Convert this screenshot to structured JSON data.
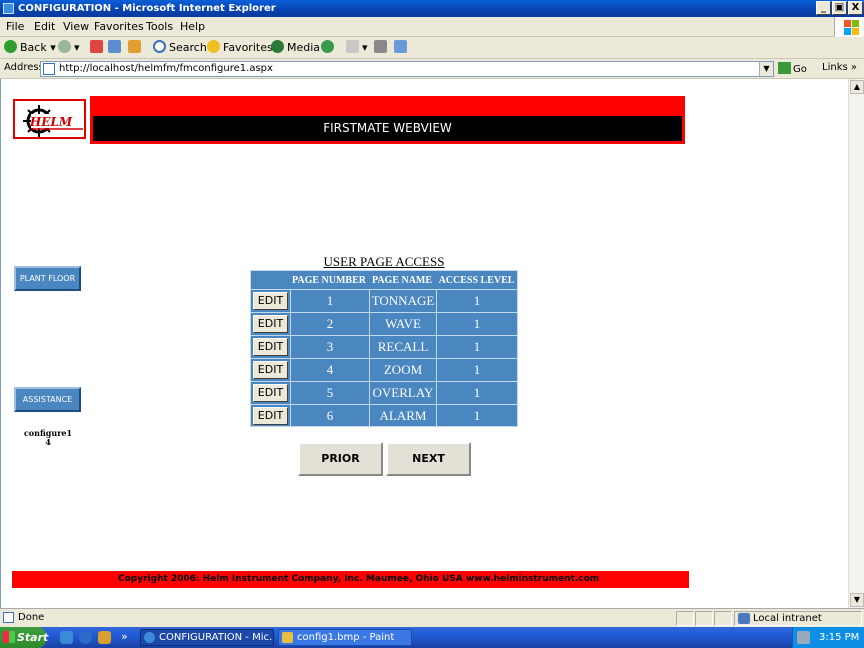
{
  "window": {
    "title": "CONFIGURATION - Microsoft Internet Explorer",
    "min_label": "_",
    "max_label": "▣",
    "close_label": "X"
  },
  "menu": [
    "File",
    "Edit",
    "View",
    "Favorites",
    "Tools",
    "Help"
  ],
  "toolbar": {
    "back": "Back",
    "search": "Search",
    "favorites": "Favorites",
    "media": "Media"
  },
  "address": {
    "label": "Address",
    "url": "http://localhost/helmfm/fmconfigure1.aspx",
    "go": "Go",
    "links": "Links",
    "links_arrow": "»"
  },
  "page": {
    "logo_text": "HELM",
    "header_title": "FIRSTMATE WEBVIEW",
    "side_buttons": {
      "plant_floor": "PLANT FLOOR",
      "assistance": "ASSISTANCE"
    },
    "page_id": {
      "name": "configure1",
      "number": "4"
    },
    "table_title": "USER PAGE ACCESS",
    "columns": [
      "PAGE NUMBER",
      "PAGE NAME",
      "ACCESS LEVEL"
    ],
    "edit_label": "EDIT",
    "rows": [
      {
        "number": "1",
        "name": "TONNAGE",
        "level": "1"
      },
      {
        "number": "2",
        "name": "WAVE",
        "level": "1"
      },
      {
        "number": "3",
        "name": "RECALL",
        "level": "1"
      },
      {
        "number": "4",
        "name": "ZOOM",
        "level": "1"
      },
      {
        "number": "5",
        "name": "OVERLAY",
        "level": "1"
      },
      {
        "number": "6",
        "name": "ALARM",
        "level": "1"
      }
    ],
    "prior": "PRIOR",
    "next": "NEXT",
    "footer": "Copyright 2006: Helm Instrument Company, Inc.   Maumee, Ohio USA   www.helminstrument.com"
  },
  "status": {
    "text": "Done",
    "zone": "Local intranet"
  },
  "taskbar": {
    "start": "Start",
    "overflow": "»",
    "tasks": [
      "CONFIGURATION - Mic...",
      "config1.bmp - Paint"
    ],
    "clock": "3:15 PM"
  },
  "colors": {
    "banner_red": "#ff0000",
    "button_blue": "#4a86c0",
    "xp_blue": "#245edb"
  }
}
